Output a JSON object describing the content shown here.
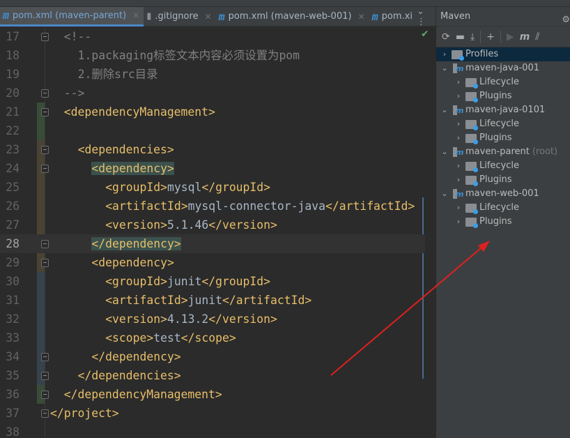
{
  "tabs": [
    {
      "label": "pom.xml (maven-parent)",
      "icon": "maven-icon",
      "active": true
    },
    {
      "label": ".gitignore",
      "icon": "file-icon",
      "active": false
    },
    {
      "label": "pom.xml (maven-web-001)",
      "icon": "maven-icon",
      "active": false
    },
    {
      "label": "pom.xi",
      "icon": "maven-icon",
      "active": false
    }
  ],
  "editor": {
    "lines": [
      {
        "n": "17",
        "indent": 1,
        "seg": [
          [
            "com",
            "<!--"
          ]
        ]
      },
      {
        "n": "18",
        "indent": 2,
        "seg": [
          [
            "com",
            "1.packaging标签文本内容必须设置为pom"
          ]
        ]
      },
      {
        "n": "19",
        "indent": 2,
        "seg": [
          [
            "com",
            "2.删除src目录"
          ]
        ]
      },
      {
        "n": "20",
        "indent": 1,
        "seg": [
          [
            "com",
            "-->"
          ]
        ]
      },
      {
        "n": "21",
        "indent": 1,
        "seg": [
          [
            "tag",
            "<dependencyManagement>"
          ]
        ]
      },
      {
        "n": "22",
        "indent": 0,
        "seg": []
      },
      {
        "n": "23",
        "indent": 2,
        "seg": [
          [
            "tag",
            "<dependencies>"
          ]
        ]
      },
      {
        "n": "24",
        "indent": 3,
        "seg": [
          [
            "tag hl",
            "<dependency>"
          ]
        ]
      },
      {
        "n": "25",
        "indent": 4,
        "seg": [
          [
            "tag",
            "<groupId>"
          ],
          [
            "txt",
            "mysql"
          ],
          [
            "tag",
            "</groupId>"
          ]
        ]
      },
      {
        "n": "26",
        "indent": 4,
        "seg": [
          [
            "tag",
            "<artifactId>"
          ],
          [
            "txt",
            "mysql-connector-java"
          ],
          [
            "tag",
            "</artifactId>"
          ]
        ]
      },
      {
        "n": "27",
        "indent": 4,
        "seg": [
          [
            "tag",
            "<version>"
          ],
          [
            "txt",
            "5.1.46"
          ],
          [
            "tag",
            "</version>"
          ]
        ]
      },
      {
        "n": "28",
        "indent": 3,
        "seg": [
          [
            "tag hl",
            "</dependency>"
          ]
        ]
      },
      {
        "n": "29",
        "indent": 3,
        "seg": [
          [
            "tag",
            "<dependency>"
          ]
        ]
      },
      {
        "n": "30",
        "indent": 4,
        "seg": [
          [
            "tag",
            "<groupId>"
          ],
          [
            "txt",
            "junit"
          ],
          [
            "tag",
            "</groupId>"
          ]
        ]
      },
      {
        "n": "31",
        "indent": 4,
        "seg": [
          [
            "tag",
            "<artifactId>"
          ],
          [
            "txt",
            "junit"
          ],
          [
            "tag",
            "</artifactId>"
          ]
        ]
      },
      {
        "n": "32",
        "indent": 4,
        "seg": [
          [
            "tag",
            "<version>"
          ],
          [
            "txt",
            "4.13.2"
          ],
          [
            "tag",
            "</version>"
          ]
        ]
      },
      {
        "n": "33",
        "indent": 4,
        "seg": [
          [
            "tag",
            "<scope>"
          ],
          [
            "txt",
            "test"
          ],
          [
            "tag",
            "</scope>"
          ]
        ]
      },
      {
        "n": "34",
        "indent": 3,
        "seg": [
          [
            "tag",
            "</dependency>"
          ]
        ]
      },
      {
        "n": "35",
        "indent": 2,
        "seg": [
          [
            "tag",
            "</dependencies>"
          ]
        ]
      },
      {
        "n": "36",
        "indent": 1,
        "seg": [
          [
            "tag",
            "</dependencyManagement>"
          ]
        ]
      },
      {
        "n": "37",
        "indent": 0,
        "seg": [
          [
            "tag",
            "</project>"
          ]
        ]
      },
      {
        "n": "38",
        "indent": 0,
        "seg": []
      }
    ],
    "current_line": "28"
  },
  "maven": {
    "title": "Maven",
    "toolbar": [
      "reload-icon",
      "add-folder-icon",
      "download-icon",
      "plus-icon",
      "run-icon",
      "maven-goal-icon",
      "toggle-offline-icon"
    ],
    "tree": [
      {
        "label": "Profiles",
        "level": 0,
        "expanded": false,
        "type": "profiles"
      },
      {
        "label": "maven-java-001",
        "level": 0,
        "expanded": true,
        "type": "project"
      },
      {
        "label": "Lifecycle",
        "level": 1,
        "expanded": false,
        "type": "folder"
      },
      {
        "label": "Plugins",
        "level": 1,
        "expanded": false,
        "type": "folder"
      },
      {
        "label": "maven-java-0101",
        "level": 0,
        "expanded": true,
        "type": "project"
      },
      {
        "label": "Lifecycle",
        "level": 1,
        "expanded": false,
        "type": "folder"
      },
      {
        "label": "Plugins",
        "level": 1,
        "expanded": false,
        "type": "folder"
      },
      {
        "label": "maven-parent",
        "suffix": "(root)",
        "level": 0,
        "expanded": true,
        "type": "project"
      },
      {
        "label": "Lifecycle",
        "level": 1,
        "expanded": false,
        "type": "folder"
      },
      {
        "label": "Plugins",
        "level": 1,
        "expanded": false,
        "type": "folder"
      },
      {
        "label": "maven-web-001",
        "level": 0,
        "expanded": true,
        "type": "project"
      },
      {
        "label": "Lifecycle",
        "level": 1,
        "expanded": false,
        "type": "folder"
      },
      {
        "label": "Plugins",
        "level": 1,
        "expanded": false,
        "type": "folder"
      }
    ]
  },
  "annotation": {
    "color": "#e02020"
  }
}
